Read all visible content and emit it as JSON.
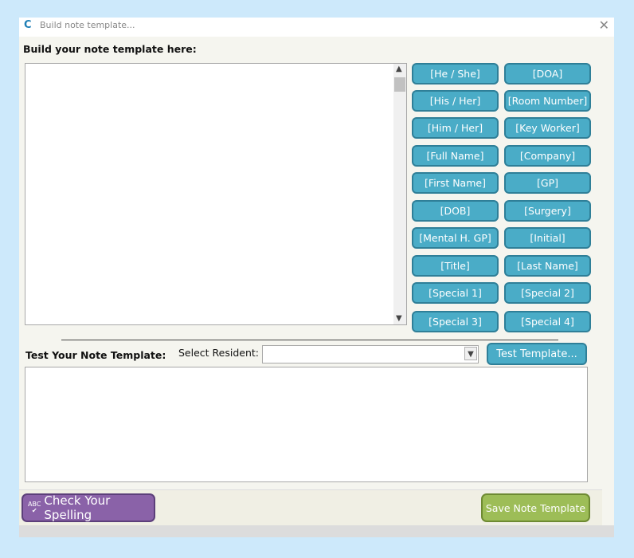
{
  "window": {
    "title": "Build note template...",
    "app_icon": "C",
    "close_glyph": "✕"
  },
  "build_section": {
    "heading": "Build your note template here:",
    "editor_value": ""
  },
  "tag_buttons": {
    "left": [
      "[He / She]",
      "[His / Her]",
      "[Him / Her]",
      "[Full Name]",
      "[First Name]",
      "[DOB]",
      "[Mental H. GP]",
      "[Title]",
      "[Special 1]",
      "[Special 3]"
    ],
    "right": [
      "[DOA]",
      "[Room Number]",
      "[Key Worker]",
      "[Company]",
      "[GP]",
      "[Surgery]",
      "[Initial]",
      "[Last Name]",
      "[Special 2]",
      "[Special 4]"
    ]
  },
  "test_section": {
    "heading": "Test Your Note Template:",
    "select_label": "Select Resident:",
    "select_value": "",
    "test_button": "Test Template...",
    "output_value": ""
  },
  "footer": {
    "spell_button": "Check Your Spelling",
    "spell_icon_text": "ABC",
    "save_button": "Save Note Template"
  },
  "colors": {
    "tag_button": "#4aacc7",
    "spell_button": "#8a62a8",
    "save_button": "#9dbd57",
    "background": "#cde9fb"
  },
  "icons": [
    "app-logo-icon",
    "close-icon",
    "scroll-up-icon",
    "scroll-down-icon",
    "dropdown-arrow-icon",
    "spellcheck-icon"
  ]
}
